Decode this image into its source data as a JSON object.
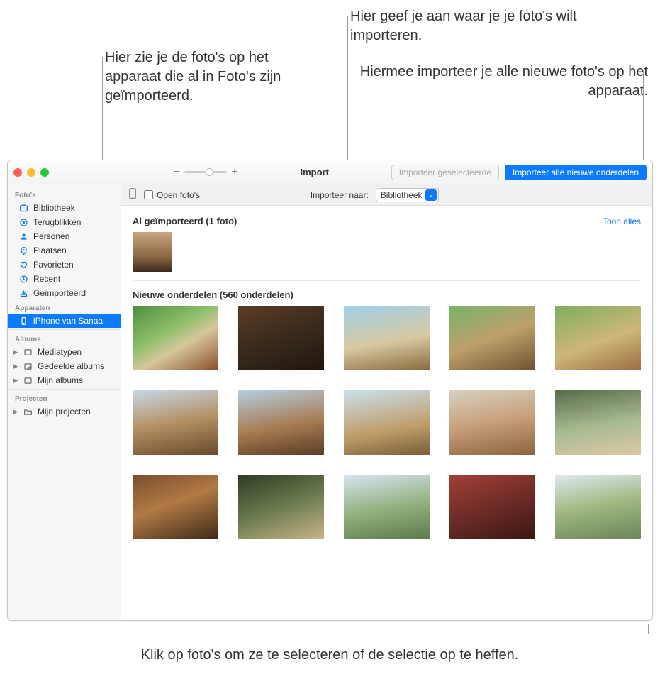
{
  "callouts": {
    "already_imported": "Hier zie je de foto's op het apparaat die al in Foto's zijn geïmporteerd.",
    "import_destination": "Hier geef je aan waar je je foto's wilt importeren.",
    "import_all_new": "Hiermee importeer je alle nieuwe foto's op het apparaat.",
    "click_to_select": "Klik op foto's om ze te selecteren of de selectie op te heffen."
  },
  "titlebar": {
    "title": "Import",
    "zoom_minus": "−",
    "zoom_plus": "+",
    "import_selected": "Importeer geselecteerde",
    "import_all_new": "Importeer alle nieuwe onderdelen"
  },
  "optionsbar": {
    "open_photos_label": "Open foto's",
    "import_to_label": "Importeer naar:",
    "destination_selected": "Bibliotheek"
  },
  "sidebar": {
    "sections": {
      "photos": "Foto's",
      "devices": "Apparaten",
      "albums": "Albums",
      "projects": "Projecten"
    },
    "photos_items": [
      {
        "label": "Bibliotheek",
        "icon": "library"
      },
      {
        "label": "Terugblikken",
        "icon": "memories"
      },
      {
        "label": "Personen",
        "icon": "people"
      },
      {
        "label": "Plaatsen",
        "icon": "places"
      },
      {
        "label": "Favorieten",
        "icon": "heart"
      },
      {
        "label": "Recent",
        "icon": "clock"
      },
      {
        "label": "Geïmporteerd",
        "icon": "imported"
      }
    ],
    "devices_items": [
      {
        "label": "iPhone van Sanaa",
        "icon": "phone",
        "selected": true
      }
    ],
    "albums_items": [
      {
        "label": "Mediatypen",
        "icon": "album",
        "disclosure": true
      },
      {
        "label": "Gedeelde albums",
        "icon": "shared-album",
        "disclosure": true
      },
      {
        "label": "Mijn albums",
        "icon": "album",
        "disclosure": true
      }
    ],
    "projects_items": [
      {
        "label": "Mijn projecten",
        "icon": "folder",
        "disclosure": true
      }
    ]
  },
  "content": {
    "already_imported_header": "Al geïmporteerd (1 foto)",
    "show_all": "Toon alles",
    "new_items_header": "Nieuwe onderdelen (560 onderdelen)"
  },
  "colors": {
    "accent": "#0a7aff"
  }
}
